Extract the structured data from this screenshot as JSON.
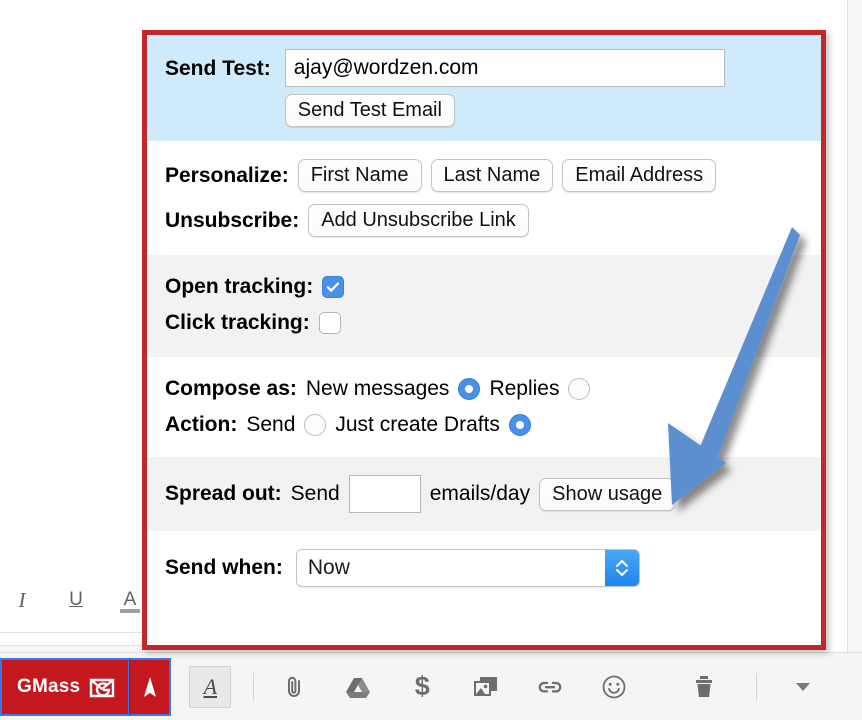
{
  "panel": {
    "accent_border_color": "#c0282d",
    "send_test": {
      "label": "Send Test:",
      "email_value": "ajay@wordzen.com",
      "email_placeholder": "",
      "send_button_label": "Send Test Email",
      "background_color": "#cfeafb"
    },
    "personalize": {
      "label": "Personalize:",
      "buttons": [
        "First Name",
        "Last Name",
        "Email Address"
      ]
    },
    "unsubscribe": {
      "label": "Unsubscribe:",
      "button_label": "Add Unsubscribe Link"
    },
    "tracking": {
      "open_label": "Open tracking:",
      "open_checked": true,
      "click_label": "Click tracking:",
      "click_checked": false
    },
    "compose_as": {
      "label": "Compose as:",
      "option_new_label": "New messages",
      "option_new_selected": true,
      "option_replies_label": "Replies",
      "option_replies_selected": false
    },
    "action": {
      "label": "Action:",
      "option_send_label": "Send",
      "option_send_selected": false,
      "option_drafts_label": "Just create Drafts",
      "option_drafts_selected": true
    },
    "spread_out": {
      "label": "Spread out:",
      "send_word": "Send",
      "amount_value": "",
      "amount_placeholder": "",
      "unit_label": "emails/day",
      "usage_button_label": "Show usage"
    },
    "send_when": {
      "label": "Send when:",
      "selected_option": "Now"
    }
  },
  "annotation": {
    "arrow_color": "#5b8fd0",
    "arrow_name": "pointer-arrow-to-show-usage"
  },
  "format_toolbar": {
    "italic": "I",
    "underline": "U",
    "text_color": "A"
  },
  "send_bar": {
    "gmass_label": "GMass",
    "gmass_background": "#c5171e",
    "icons": [
      "text-format-icon",
      "attachment-icon",
      "google-drive-icon",
      "insert-money-icon",
      "insert-photo-icon",
      "insert-link-icon",
      "insert-emoji-icon",
      "discard-icon",
      "more-options-icon"
    ],
    "money_glyph": "$",
    "text_format_glyph": "A"
  }
}
